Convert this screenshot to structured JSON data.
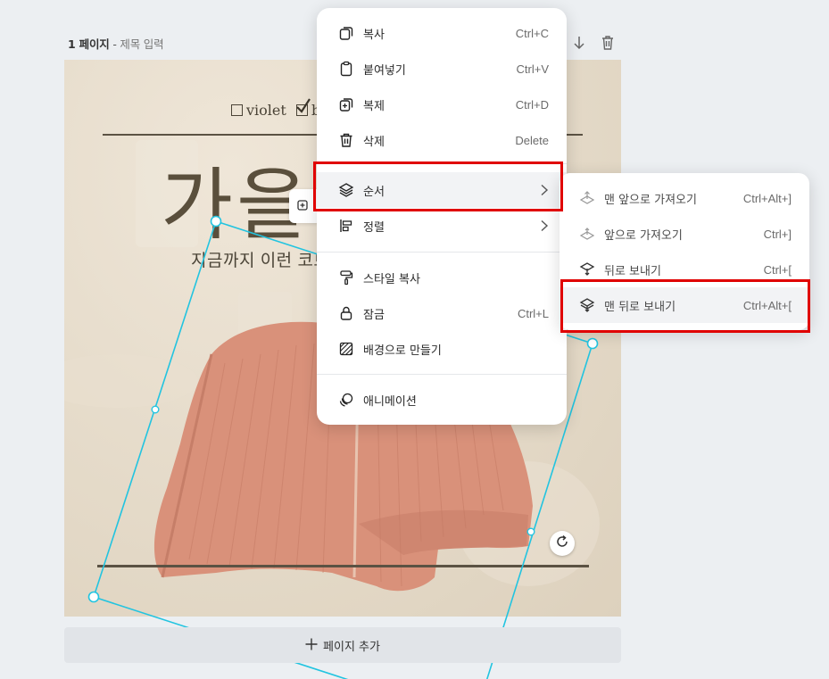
{
  "page_header": {
    "number": "1 페이지",
    "separator": " - ",
    "title": "제목 입력"
  },
  "header_icons": [
    "arrow-down-icon",
    "trash-icon"
  ],
  "canvas": {
    "checkbox_1": "violet",
    "checkbox_2": "b",
    "big_title": "가을",
    "subtitle": "지금까지 이런 코트"
  },
  "add_page": {
    "label": "페이지 추가"
  },
  "context_menu": {
    "items": [
      {
        "icon": "copy-icon",
        "label": "복사",
        "shortcut": "Ctrl+C"
      },
      {
        "icon": "paste-icon",
        "label": "붙여넣기",
        "shortcut": "Ctrl+V"
      },
      {
        "icon": "duplicate-icon",
        "label": "복제",
        "shortcut": "Ctrl+D"
      },
      {
        "icon": "trash-icon",
        "label": "삭제",
        "shortcut": "Delete"
      },
      {
        "icon": "layers-icon",
        "label": "순서",
        "shortcut": ""
      },
      {
        "icon": "align-icon",
        "label": "정렬",
        "shortcut": ""
      },
      {
        "icon": "paint-roller-icon",
        "label": "스타일 복사",
        "shortcut": ""
      },
      {
        "icon": "lock-icon",
        "label": "잠금",
        "shortcut": "Ctrl+L"
      },
      {
        "icon": "background-icon",
        "label": "배경으로 만들기",
        "shortcut": ""
      },
      {
        "icon": "animation-icon",
        "label": "애니메이션",
        "shortcut": ""
      }
    ]
  },
  "order_submenu": {
    "items": [
      {
        "icon": "bring-to-front-icon",
        "label": "맨 앞으로 가져오기",
        "shortcut": "Ctrl+Alt+]"
      },
      {
        "icon": "bring-forward-icon",
        "label": "앞으로 가져오기",
        "shortcut": "Ctrl+]"
      },
      {
        "icon": "send-backward-icon",
        "label": "뒤로 보내기",
        "shortcut": "Ctrl+["
      },
      {
        "icon": "send-to-back-icon",
        "label": "맨 뒤로 보내기",
        "shortcut": "Ctrl+Alt+["
      }
    ]
  },
  "colors": {
    "highlight_box": "#e00000",
    "selection": "#22c4e0",
    "canvas_bg": "#e6dccb",
    "jacket": "#d9917a"
  }
}
